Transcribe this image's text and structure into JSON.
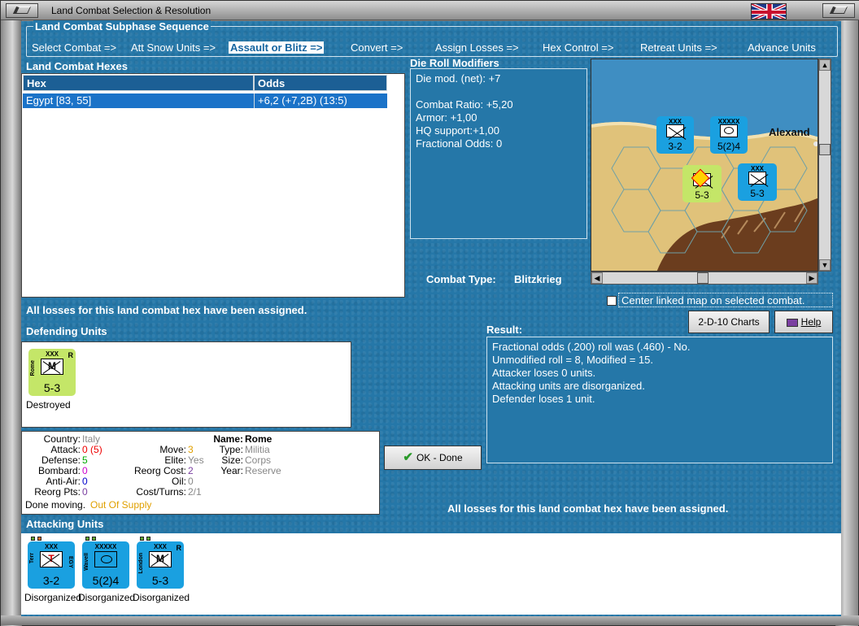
{
  "window": {
    "title": "Land Combat Selection & Resolution"
  },
  "sequence": {
    "title": "Land Combat Subphase Sequence",
    "steps": [
      "Select Combat =>",
      "Att Snow Units =>",
      "Assault or Blitz =>",
      "Convert =>",
      "Assign Losses =>",
      "Hex Control =>",
      "Retreat Units =>",
      "Advance Units"
    ],
    "active_step": "Assault or Blitz =>"
  },
  "hexes": {
    "title": "Land Combat Hexes",
    "columns": [
      "Hex",
      "Odds"
    ],
    "rows": [
      {
        "hex": "Egypt [83, 55]",
        "odds": "+6,2 (+7,2B) (13:5)"
      }
    ]
  },
  "die_roll": {
    "title": "Die Roll Modifiers",
    "lines": [
      "Die mod. (net): +7",
      "",
      "Combat Ratio: +5,20",
      "Armor: +1,00",
      "HQ support:+1,00",
      "Fractional Odds: 0"
    ]
  },
  "map": {
    "city_label": "Alexand"
  },
  "combat_type": {
    "label": "Combat Type:",
    "value": "Blitzkrieg"
  },
  "center_map_label": "Center linked map on selected combat.",
  "losses_msg": "All losses for this land combat hex have been assigned.",
  "buttons": {
    "charts": "2-D-10 Charts",
    "help": "Help",
    "ok": "OK - Done"
  },
  "result": {
    "title": "Result:",
    "lines": [
      "Fractional odds (.200) roll was (.460)  - No.",
      "Unmodified roll = 8, Modified = 15.",
      "Attacker loses 0 units.",
      "Attacking units are disorganized.",
      "Defender loses 1 unit."
    ]
  },
  "defending": {
    "title": "Defending Units",
    "units": [
      {
        "size": "XXX",
        "letter": "M",
        "name": "Rome",
        "strength": "5-3",
        "reserve": "R",
        "status": "Destroyed"
      }
    ]
  },
  "details": {
    "country_label": "Country:",
    "country": "Italy",
    "attack_label": "Attack:",
    "attack": "0",
    "attack_paren": "(5)",
    "defense_label": "Defense:",
    "defense": "5",
    "bombard_label": "Bombard:",
    "bombard": "0",
    "antiair_label": "Anti-Air:",
    "antiair": "0",
    "reorgpts_label": "Reorg Pts:",
    "reorgpts": "0",
    "move_label": "Move:",
    "move": "3",
    "elite_label": "Elite:",
    "elite": "Yes",
    "reorgcost_label": "Reorg Cost:",
    "reorgcost": "2",
    "oil_label": "Oil:",
    "oil": "0",
    "costturns_label": "Cost/Turns:",
    "costturns": "2/1",
    "name_label": "Name:",
    "name": "Rome",
    "type_label": "Type:",
    "type": "Militia",
    "size_label": "Size:",
    "size": "Corps",
    "year_label": "Year:",
    "year": "Reserve",
    "done_moving": "Done moving.",
    "supply": "Out Of Supply"
  },
  "attacking": {
    "title": "Attacking Units",
    "units": [
      {
        "size": "XXX",
        "letter": "T",
        "name": "Terr",
        "nation": "EGY",
        "strength": "3-2",
        "status": "Disorganized"
      },
      {
        "size": "XXXXX",
        "letter": "",
        "name": "Wavell",
        "strength": "5(2)4",
        "status": "Disorganized"
      },
      {
        "size": "XXX",
        "letter": "M",
        "name": "London",
        "reserve": "R",
        "strength": "5-3",
        "status": "Disorganized"
      }
    ]
  },
  "colors": {
    "panel": "#2577a8",
    "unit_cyan": "#1aa0e0",
    "unit_lime": "#c4e668",
    "selection": "#1b73c8"
  }
}
